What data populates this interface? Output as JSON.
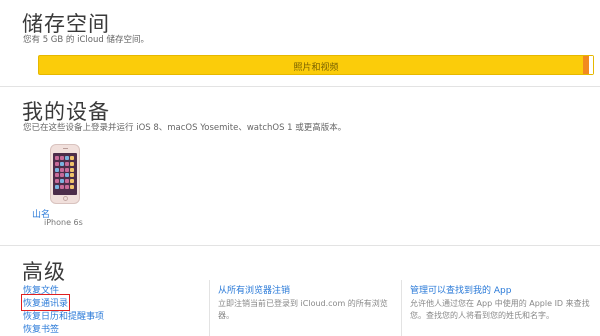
{
  "storage": {
    "title": "储存空间",
    "subtitle": "您有 5 GB 的 iCloud 储存空间。",
    "bar_label": "照片和视频",
    "colors": {
      "photos": "#fbcc0a",
      "other": "#f28a1e"
    }
  },
  "devices": {
    "title": "我的设备",
    "subtitle": "您已在这些设备上登录并运行 iOS 8、macOS Yosemite、watchOS 1 或更高版本。",
    "items": [
      {
        "name": "山名",
        "model": "iPhone 6s",
        "icon": "iphone-icon"
      }
    ]
  },
  "advanced": {
    "title": "高级",
    "restore_links": [
      "恢复文件",
      "恢复通讯录",
      "恢复日历和提醒事项",
      "恢复书签"
    ],
    "sign_out": {
      "title": "从所有浏览器注销",
      "desc": "立即注销当前已登录到 iCloud.com 的所有浏览器。"
    },
    "manage": {
      "title": "管理可以查找到我的 App",
      "desc": "允许他人通过您在 App 中使用的 Apple ID 来查找您。查找您的人将看到您的姓氏和名字。"
    }
  }
}
